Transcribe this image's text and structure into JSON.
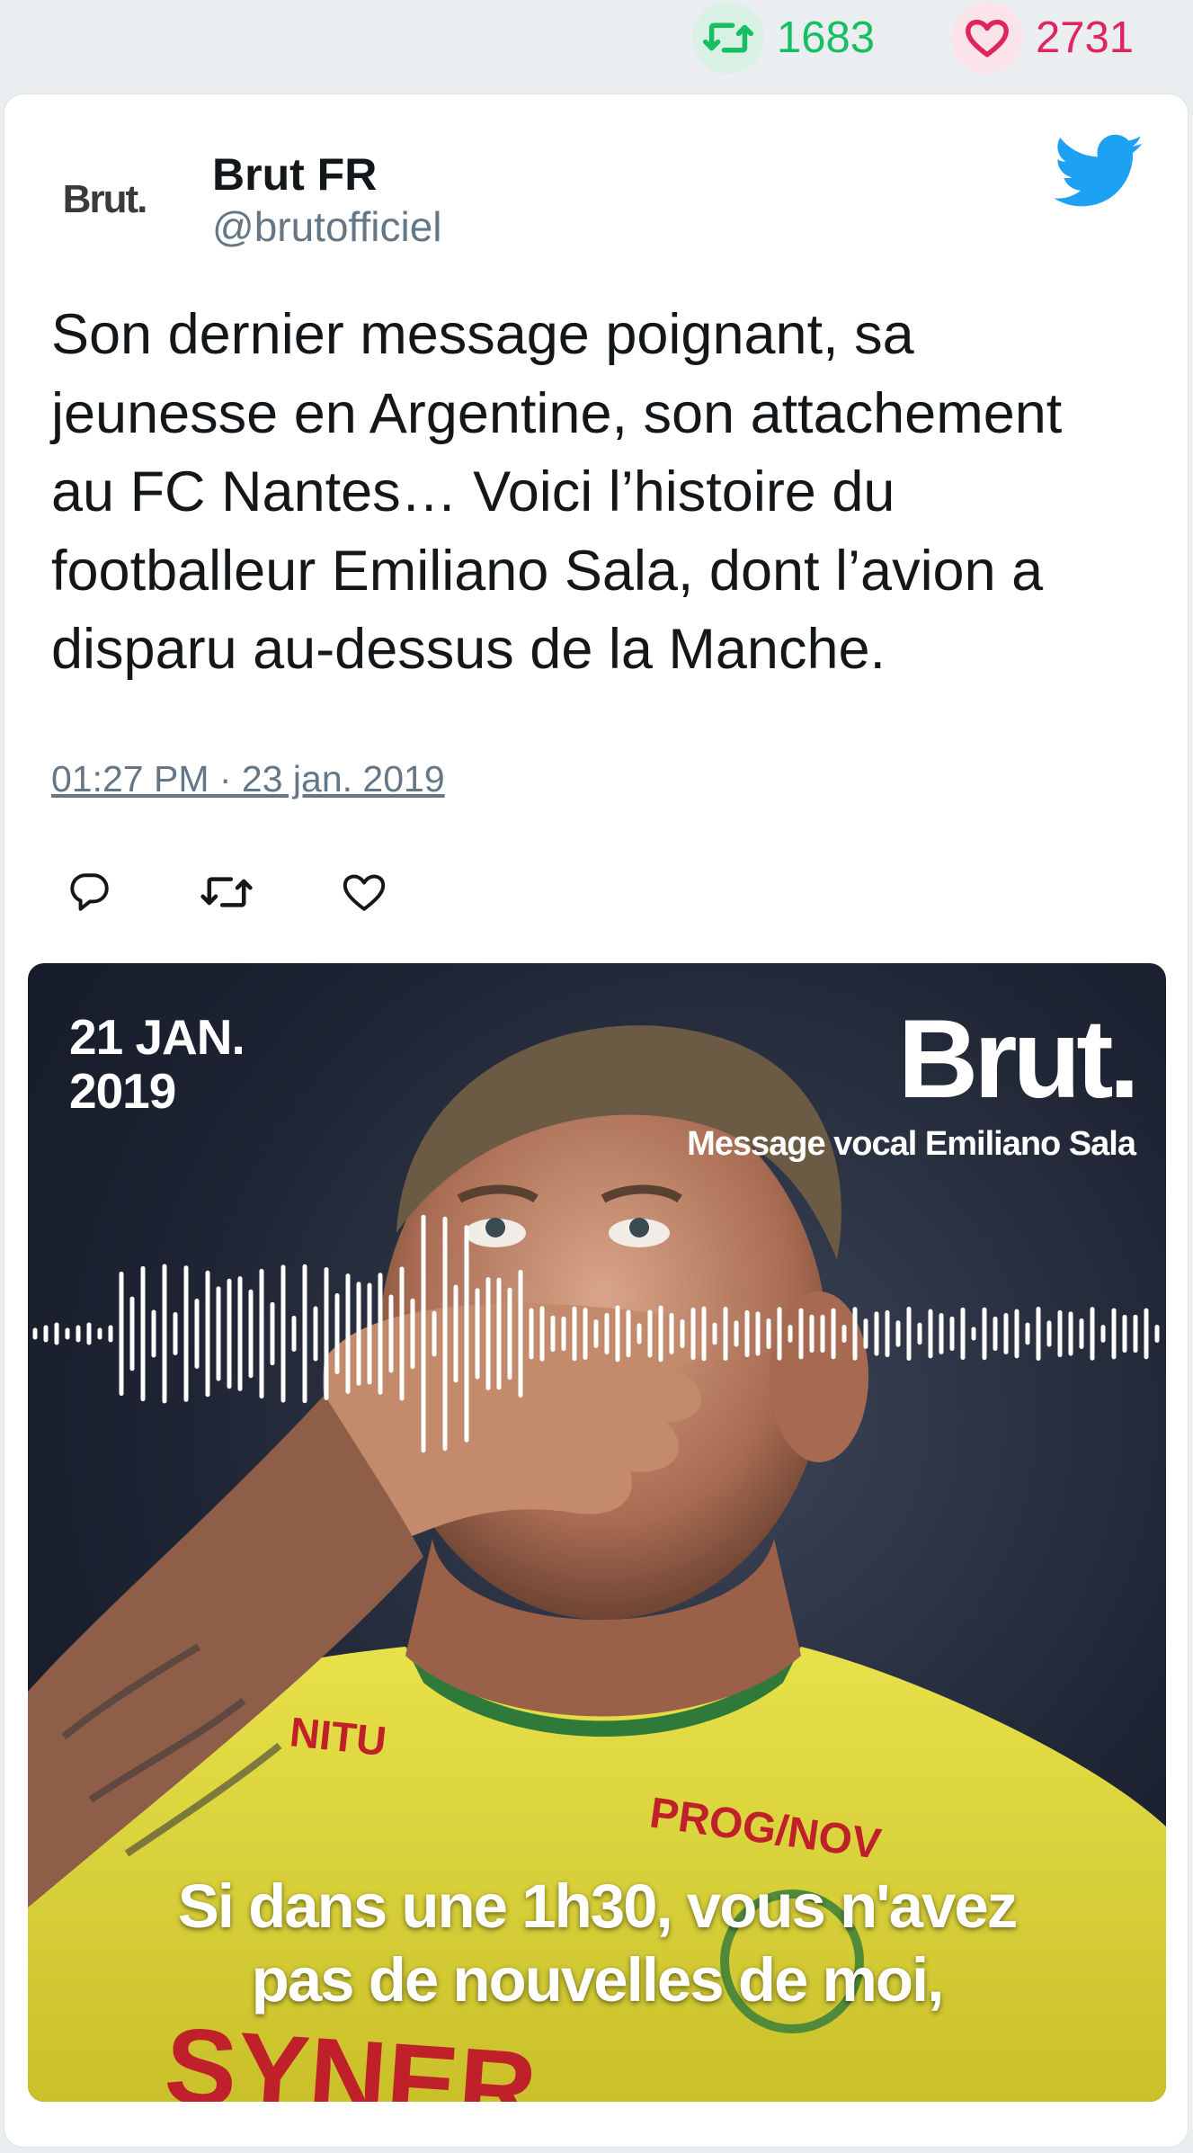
{
  "stats": {
    "retweets": "1683",
    "likes": "2731",
    "retweet_icon": "retweet-icon",
    "like_icon": "heart-icon",
    "retweet_color": "#17bf63",
    "like_color": "#e0245e"
  },
  "tweet": {
    "avatar_text": "Brut.",
    "author_name": "Brut FR",
    "author_handle": "@brutofficiel",
    "platform_icon": "twitter-bird-icon",
    "platform_color": "#1da1f2",
    "text": "Son dernier message poignant, sa\njeunesse en Argentine, son attachement\nau FC Nantes… Voici l’histoire du\nfootballeur Emiliano Sala, dont l’avion a\ndisparu au-dessus de la Manche.",
    "timestamp": "01:27 PM · 23 jan. 2019",
    "actions": {
      "reply_icon": "reply-icon",
      "retweet_icon": "retweet-icon",
      "like_icon": "heart-icon"
    }
  },
  "media": {
    "date": "21 JAN.\n2019",
    "brand": "Brut.",
    "brand_caption": "Message vocal Emiliano Sala",
    "subtitle": "Si dans une 1h30, vous n'avez\npas de nouvelles de moi,",
    "jersey_text_1": "NITU",
    "jersey_text_2": "PROG/NOV",
    "jersey_text_3": "SYNER",
    "waveform_icon": "audio-waveform"
  }
}
